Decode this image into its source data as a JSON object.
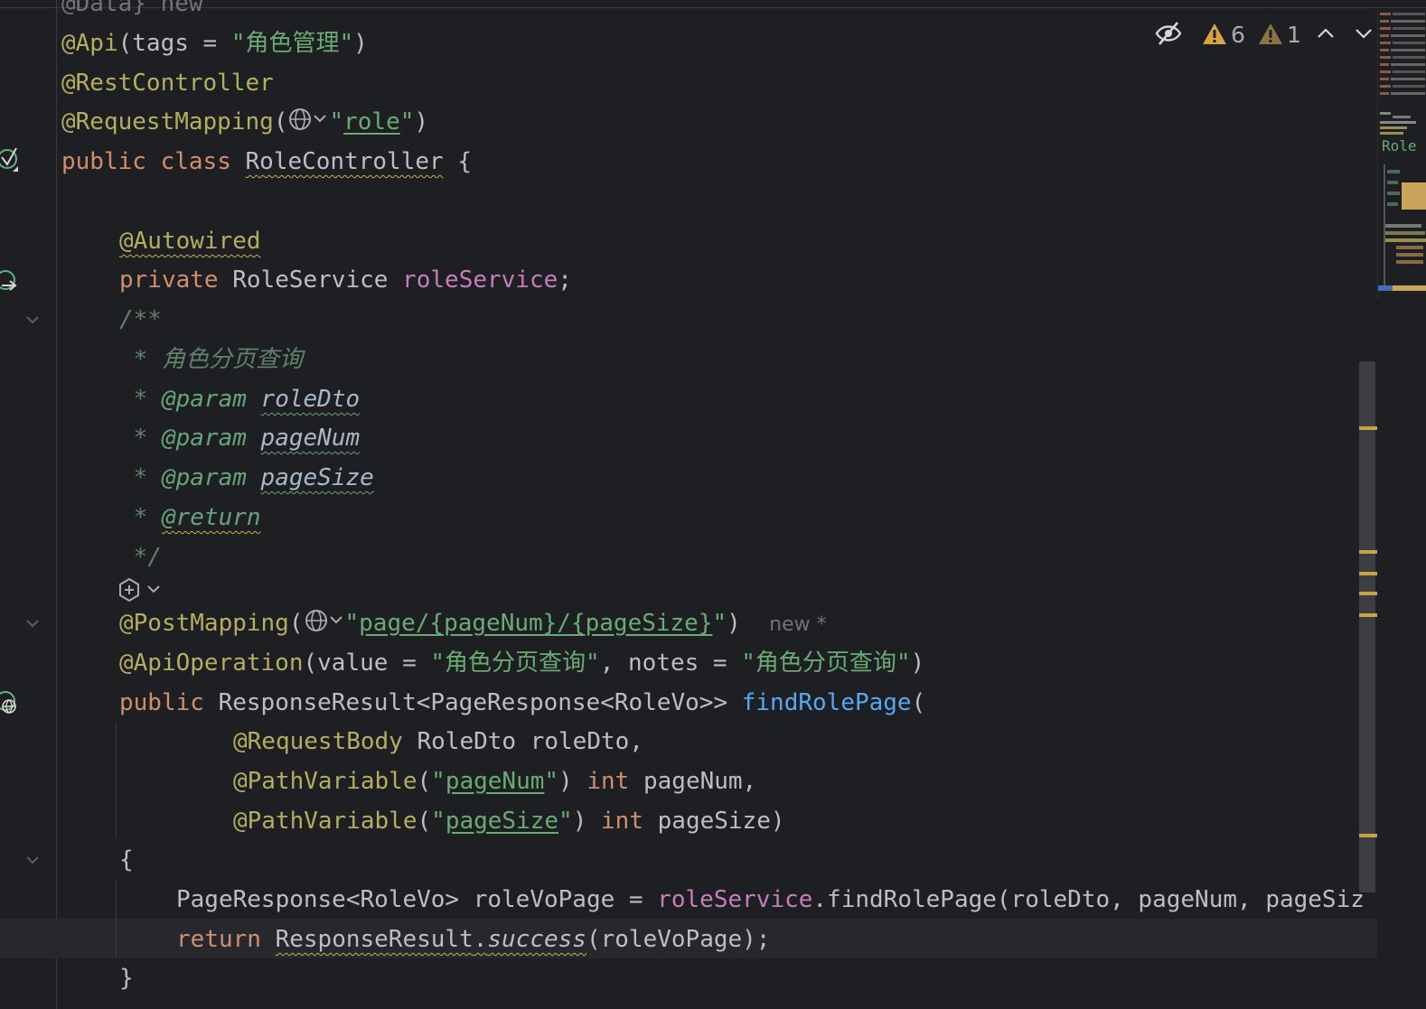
{
  "toolbar": {
    "hide_inlays_icon": "eye-crossed-icon",
    "warning_count": "6",
    "weak_warning_count": "1"
  },
  "code": {
    "truncated_top": "@Data} new",
    "l1": {
      "annot": "@Api",
      "open": "(tags = ",
      "str": "\"角色管理\"",
      "close": ")"
    },
    "l2": {
      "annot": "@RestController"
    },
    "l3": {
      "annot": "@RequestMapping",
      "open": "(",
      "str_q1": "\"",
      "str_v": "role",
      "str_q2": "\"",
      "close": ")"
    },
    "l4": {
      "kw1": "public",
      "kw2": "class",
      "name": "RoleController",
      "brace": " {"
    },
    "l6": {
      "annot": "@Autowired"
    },
    "l7": {
      "kw": "private",
      "type": " RoleService ",
      "field": "roleService",
      "semi": ";"
    },
    "l8": {
      "doc": "/**"
    },
    "l9": {
      "doc": " * 角色分页查询"
    },
    "l10": {
      "star": " * ",
      "tag": "@param",
      "param": "roleDto"
    },
    "l11": {
      "star": " * ",
      "tag": "@param",
      "param": "pageNum"
    },
    "l12": {
      "star": " * ",
      "tag": "@param",
      "param": "pageSize"
    },
    "l13": {
      "star": " * ",
      "tag": "@return"
    },
    "l14": {
      "doc": " */"
    },
    "l16": {
      "annot": "@PostMapping",
      "open": "(",
      "str_q1": "\"",
      "str_v": "page/{pageNum}/{pageSize}",
      "str_q2": "\"",
      "close": ")",
      "inlay": "new *"
    },
    "l17": {
      "annot": "@ApiOperation",
      "p1": "(value = ",
      "s1": "\"角色分页查询\"",
      "p2": ", notes = ",
      "s2": "\"角色分页查询\"",
      "close": ")"
    },
    "l18": {
      "kw": "public",
      "type": " ResponseResult<PageResponse<RoleVo>> ",
      "fn": "findRolePage",
      "open": "("
    },
    "l19": {
      "annot": "@RequestBody",
      "rest": " RoleDto roleDto,"
    },
    "l20": {
      "annot": "@PathVariable",
      "open": "(",
      "q1": "\"",
      "v": "pageNum",
      "q2": "\"",
      "close": ") ",
      "kw": "int",
      "rest": " pageNum,"
    },
    "l21": {
      "annot": "@PathVariable",
      "open": "(",
      "q1": "\"",
      "v": "pageSize",
      "q2": "\"",
      "close": ") ",
      "kw": "int",
      "rest": " pageSize)"
    },
    "l22": {
      "brace": "{"
    },
    "l23": {
      "a": "PageResponse<RoleVo> roleVoPage = ",
      "field": "roleService",
      "b": ".findRolePage(roleDto, pageNum, pageSiz"
    },
    "l24": {
      "kw": "return",
      "sp": " ",
      "cls": "ResponseResult",
      "dot": ".",
      "m": "success",
      "rest": "(roleVoPage);"
    },
    "l25": {
      "brace": "}"
    }
  },
  "minimap": {
    "label": "Role"
  },
  "colors": {
    "background": "#1e1f22",
    "keyword": "#cf8e6d",
    "annotation": "#b3ae60",
    "string": "#6aab73",
    "field": "#c77dbb",
    "function": "#56a8f5",
    "warning": "#d9a343"
  }
}
